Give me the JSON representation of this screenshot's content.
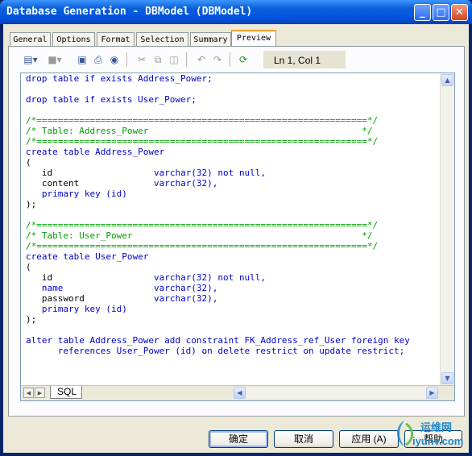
{
  "window": {
    "title": "Database Generation - DBModel (DBModel)",
    "controls": {
      "minimize": "_",
      "maximize": "□",
      "close": "✕"
    }
  },
  "tabs": [
    {
      "label": "General"
    },
    {
      "label": "Options"
    },
    {
      "label": "Format"
    },
    {
      "label": "Selection"
    },
    {
      "label": "Summary"
    },
    {
      "label": "Preview",
      "active": true
    }
  ],
  "toolbar": {
    "icons": [
      "page-menu-icon",
      "disk-menu-icon",
      "save-icon",
      "print-icon",
      "find-icon",
      "cut-icon",
      "copy-icon",
      "paste-icon",
      "undo-icon",
      "redo-icon",
      "refresh-icon"
    ],
    "cursor_position": "Ln 1, Col 1"
  },
  "editor": {
    "lines": [
      [
        {
          "t": "drop table if exists Address_Power;",
          "c": "kw"
        }
      ],
      [
        {
          "t": "",
          "c": ""
        }
      ],
      [
        {
          "t": "drop table if exists User_Power;",
          "c": "kw"
        }
      ],
      [
        {
          "t": "",
          "c": ""
        }
      ],
      [
        {
          "t": "/*==============================================================*/",
          "c": "cm"
        }
      ],
      [
        {
          "t": "/* Table: Address_Power                                        */",
          "c": "cm"
        }
      ],
      [
        {
          "t": "/*==============================================================*/",
          "c": "cm"
        }
      ],
      [
        {
          "t": "create table Address_Power",
          "c": "kw"
        }
      ],
      [
        {
          "t": "(",
          "c": ""
        }
      ],
      [
        {
          "t": "   id                   ",
          "c": ""
        },
        {
          "t": "varchar(32) not null,",
          "c": "kw"
        }
      ],
      [
        {
          "t": "   content              ",
          "c": ""
        },
        {
          "t": "varchar(32),",
          "c": "kw"
        }
      ],
      [
        {
          "t": "   primary key (id)",
          "c": "kw"
        }
      ],
      [
        {
          "t": ");",
          "c": ""
        }
      ],
      [
        {
          "t": "",
          "c": ""
        }
      ],
      [
        {
          "t": "/*==============================================================*/",
          "c": "cm"
        }
      ],
      [
        {
          "t": "/* Table: User_Power                                           */",
          "c": "cm"
        }
      ],
      [
        {
          "t": "/*==============================================================*/",
          "c": "cm"
        }
      ],
      [
        {
          "t": "create table User_Power",
          "c": "kw"
        }
      ],
      [
        {
          "t": "(",
          "c": ""
        }
      ],
      [
        {
          "t": "   id                   ",
          "c": ""
        },
        {
          "t": "varchar(32) not null,",
          "c": "kw"
        }
      ],
      [
        {
          "t": "   name                 ",
          "c": "kw"
        },
        {
          "t": "varchar(32),",
          "c": "kw"
        }
      ],
      [
        {
          "t": "   password             ",
          "c": ""
        },
        {
          "t": "varchar(32),",
          "c": "kw"
        }
      ],
      [
        {
          "t": "   primary key (id)",
          "c": "kw"
        }
      ],
      [
        {
          "t": ");",
          "c": ""
        }
      ],
      [
        {
          "t": "",
          "c": ""
        }
      ],
      [
        {
          "t": "alter table Address_Power add constraint FK_Address_ref_User foreign key",
          "c": "kw"
        }
      ],
      [
        {
          "t": "      references User_Power (id) on delete restrict on update restrict;",
          "c": "kw"
        }
      ]
    ],
    "sheet_tab": "SQL"
  },
  "buttons": {
    "ok": "确定",
    "cancel": "取消",
    "apply": "应用 (A)",
    "help": "帮助"
  },
  "watermark": {
    "line1": "运维网",
    "line2": "iyunv.com"
  },
  "colors": {
    "keyword": "#0000c8",
    "comment": "#00a000",
    "title_bar": "#0054e3"
  }
}
